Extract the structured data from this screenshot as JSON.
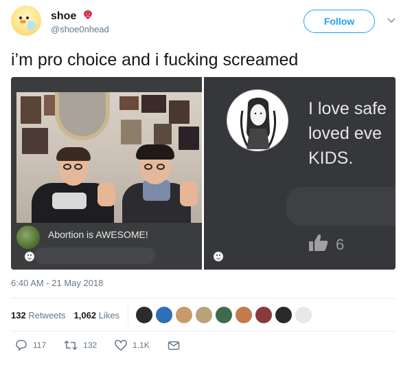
{
  "author": {
    "display_name": "shoe",
    "handle": "@shoe0nhead",
    "follow_label": "Follow"
  },
  "tweet": {
    "text": "i’m pro choice and i fucking screamed",
    "timestamp": "6:40 AM - 21 May 2018"
  },
  "media": {
    "left_comment": "Abortion is AWESOME!",
    "right_lines": [
      "I love safe",
      "loved eve",
      "KIDS."
    ],
    "right_like_count": "6"
  },
  "stats": {
    "retweets_count": "132",
    "retweets_label": "Retweets",
    "likes_count": "1,062",
    "likes_label": "Likes",
    "face_colors": [
      "#2b2b2b",
      "#2d6fb8",
      "#c89a6a",
      "#b9a27a",
      "#3f6b4c",
      "#c47a4a",
      "#8a3a3a",
      "#2a2a2a",
      "#e8e8e8"
    ]
  },
  "actions": {
    "reply_count": "117",
    "retweet_count": "132",
    "like_count": "1.1K"
  },
  "colors": {
    "accent": "#1da1f2",
    "text_primary": "#14171a",
    "text_secondary": "#657786"
  }
}
